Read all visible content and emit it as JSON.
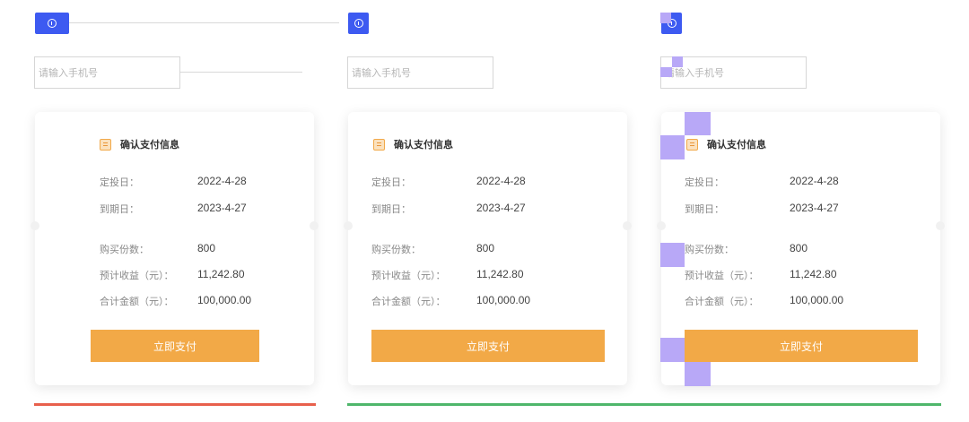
{
  "colors": {
    "badge": "#3d5af1",
    "accent": "#f2a947",
    "error_bar": "#e8604c",
    "success_bar": "#4fb66b",
    "overlay": "#b8a8f7"
  },
  "panels": [
    {
      "badge_icon": "info-icon",
      "phone_placeholder": "请输入手机号",
      "card": {
        "title": "确认支付信息",
        "rows": [
          {
            "label": "定投日：",
            "value": "2022-4-28"
          },
          {
            "label": "到期日：",
            "value": "2023-4-27"
          },
          {
            "label": "购买份数：",
            "value": "800"
          },
          {
            "label": "预计收益（元）：",
            "value": "11,242.80"
          },
          {
            "label": "合计金额（元）：",
            "value": "100,000.00"
          }
        ],
        "pay_button": "立即支付"
      }
    },
    {
      "badge_icon": "info-icon",
      "phone_placeholder": "请输入手机号",
      "card": {
        "title": "确认支付信息",
        "rows": [
          {
            "label": "定投日：",
            "value": "2022-4-28"
          },
          {
            "label": "到期日：",
            "value": "2023-4-27"
          },
          {
            "label": "购买份数：",
            "value": "800"
          },
          {
            "label": "预计收益（元）：",
            "value": "11,242.80"
          },
          {
            "label": "合计金额（元）：",
            "value": "100,000.00"
          }
        ],
        "pay_button": "立即支付"
      }
    },
    {
      "badge_icon": "info-icon",
      "phone_placeholder": "请输入手机号",
      "card": {
        "title": "确认支付信息",
        "rows": [
          {
            "label": "定投日：",
            "value": "2022-4-28"
          },
          {
            "label": "到期日：",
            "value": "2023-4-27"
          },
          {
            "label": "购买份数：",
            "value": "800"
          },
          {
            "label": "预计收益（元）：",
            "value": "11,242.80"
          },
          {
            "label": "合计金额（元）：",
            "value": "100,000.00"
          }
        ],
        "pay_button": "立即支付"
      }
    }
  ]
}
